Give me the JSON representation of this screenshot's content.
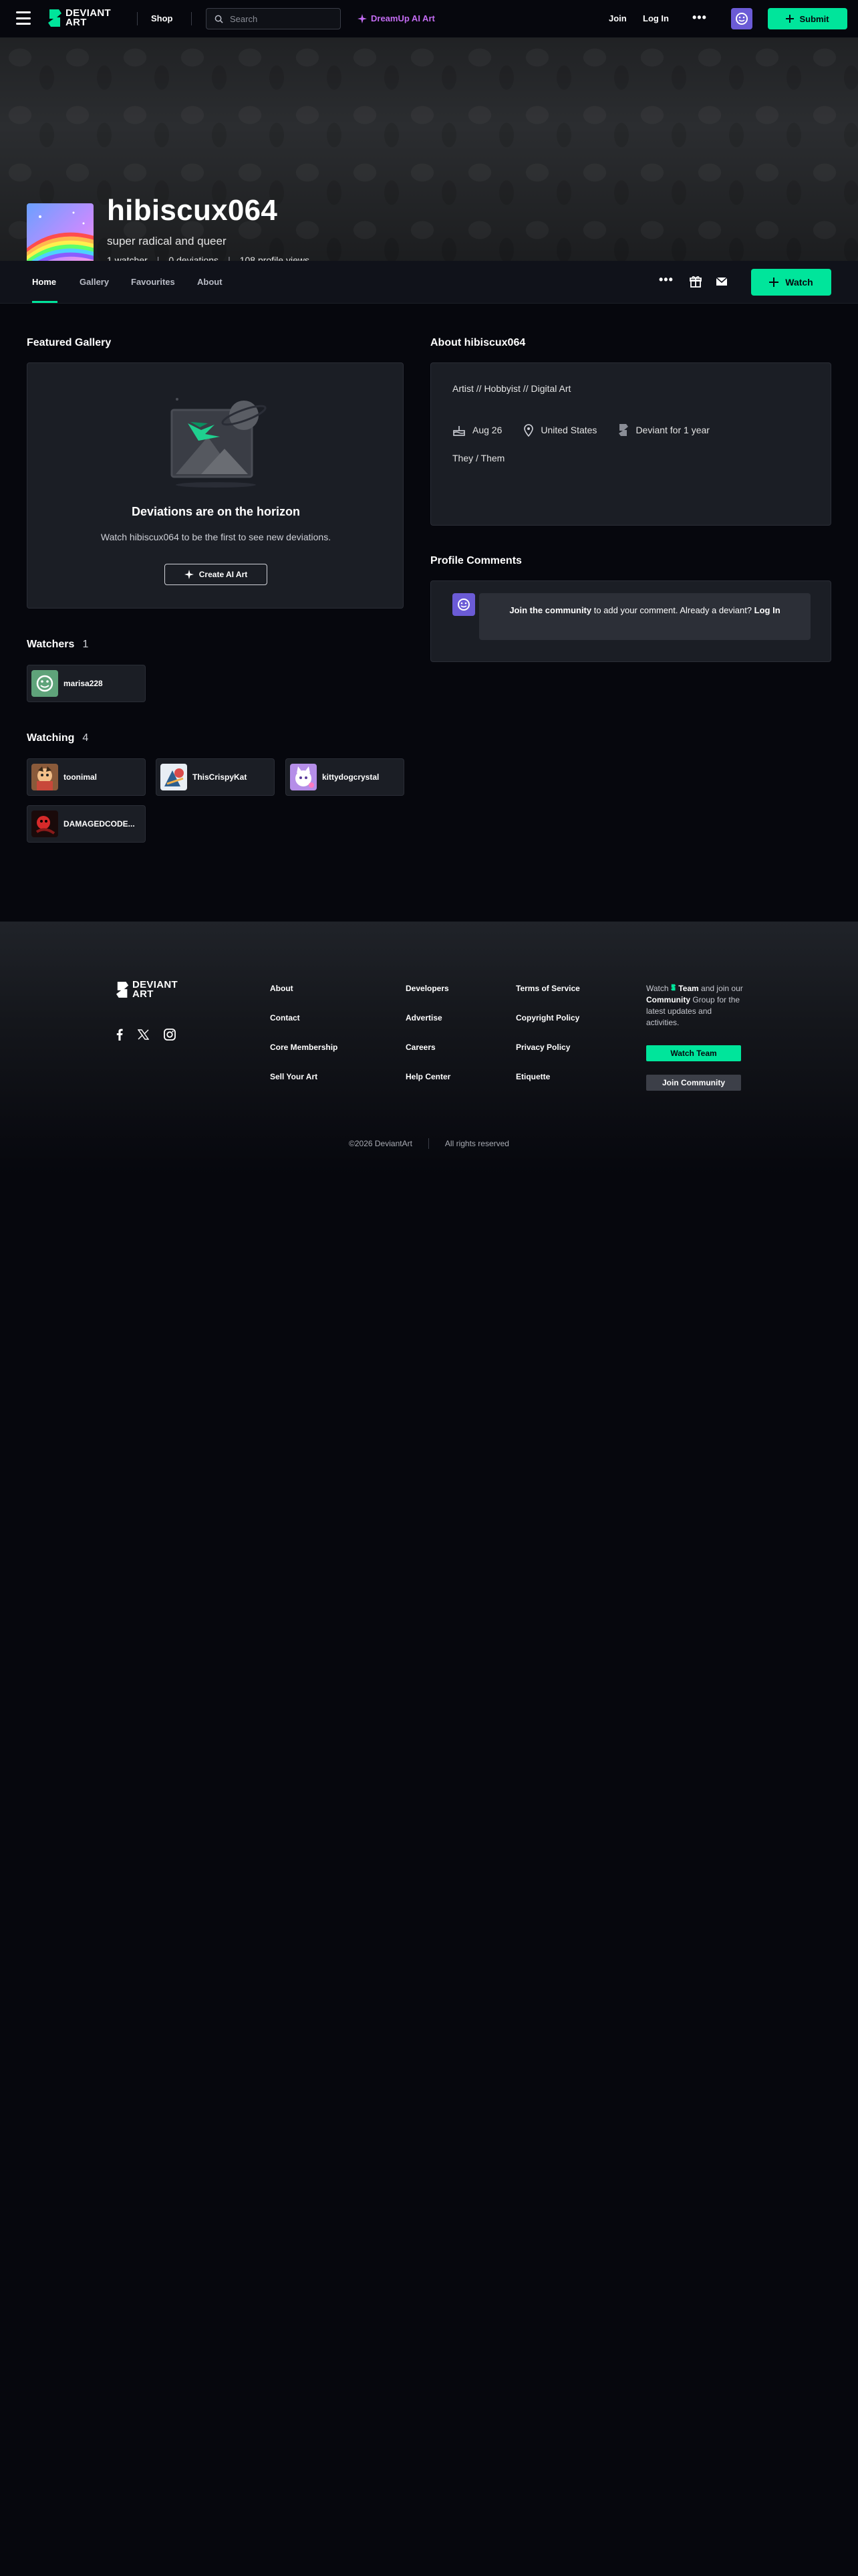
{
  "topbar": {
    "logo_line1": "DEVIANT",
    "logo_line2": "ART",
    "shop": "Shop",
    "search_placeholder": "Search",
    "dreamup": "DreamUp AI Art",
    "join": "Join",
    "login": "Log In",
    "more": "•••",
    "submit": "Submit"
  },
  "profile": {
    "username": "hibiscux064",
    "tagline": "super radical and queer",
    "watchers": "1 watcher",
    "deviations": "0 deviations",
    "views": "108 profile views",
    "stat_sep": "|"
  },
  "tabs": [
    {
      "label": "Home",
      "active": true
    },
    {
      "label": "Gallery"
    },
    {
      "label": "Favourites"
    },
    {
      "label": "About"
    }
  ],
  "tabbar": {
    "more": "•••",
    "watch": "Watch"
  },
  "featured": {
    "heading": "Featured Gallery",
    "title": "Deviations are on the horizon",
    "subtitle": "Watch hibiscux064 to be the first to see new deviations.",
    "button": "Create AI Art"
  },
  "about": {
    "heading": "About hibiscux064",
    "roles": "Artist  //  Hobbyist  //  Digital Art",
    "birthday": "Aug 26",
    "location": "United States",
    "deviant_for": "Deviant for 1 year",
    "pronouns": "They / Them"
  },
  "comments": {
    "heading": "Profile Comments",
    "join_link": "Join the community",
    "text_mid": " to add your comment. Already a deviant? ",
    "login_link": "Log In"
  },
  "watchers": {
    "heading": "Watchers",
    "count": "1",
    "users": [
      {
        "name": "marisa228"
      }
    ]
  },
  "watching": {
    "heading": "Watching",
    "count": "4",
    "users": [
      {
        "name": "toonimal"
      },
      {
        "name": "ThisCrispyKat"
      },
      {
        "name": "kittydogcrystal"
      },
      {
        "name": "DAMAGEDCODE..."
      }
    ]
  },
  "footer": {
    "col1": [
      "About",
      "Contact",
      "Core Membership",
      "Sell Your Art"
    ],
    "col2": [
      "Developers",
      "Advertise",
      "Careers",
      "Help Center"
    ],
    "col3": [
      "Terms of Service",
      "Copyright Policy",
      "Privacy Policy",
      "Etiquette"
    ],
    "team_text_1": "Watch ",
    "team_word": "Team",
    "team_text_2": " and join our ",
    "community_word": "Community",
    "team_text_3": " Group for the latest updates and activities.",
    "watch_team": "Watch Team",
    "join_community": "Join Community",
    "copyright": "©2026 DeviantArt",
    "rights": "All rights reserved"
  },
  "colors": {
    "accent": "#00e59b",
    "dreamup": "#c36cf2",
    "bg": "#06070d",
    "card": "#1b1e25"
  }
}
